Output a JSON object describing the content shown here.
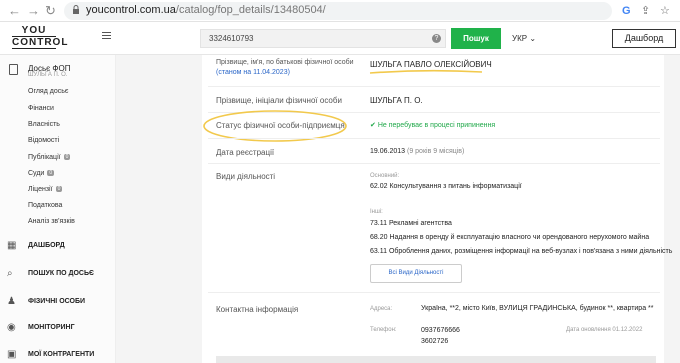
{
  "browser": {
    "url_host": "youcontrol.com.ua",
    "url_path": "/catalog/fop_details/13480504/"
  },
  "logo": {
    "line1": "YOU",
    "line2": "CONTROL"
  },
  "search": {
    "value": "3324610793",
    "button": "Пошук",
    "help": "?"
  },
  "lang": "УКР",
  "dashboard_btn": "Дашборд",
  "sidebar": {
    "dossier_title": "Досьє ФОП",
    "dossier_sub": "ШУЛЬГА П. О.",
    "sub_items": [
      {
        "label": "Огляд досьє"
      },
      {
        "label": "Фінанси"
      },
      {
        "label": "Власність"
      },
      {
        "label": "Відомості"
      },
      {
        "label": "Публікації",
        "badge": "0"
      },
      {
        "label": "Суди",
        "badge": "0"
      },
      {
        "label": "Ліцензії",
        "badge": "0"
      },
      {
        "label": "Податкова"
      },
      {
        "label": "Аналіз зв'язків"
      }
    ],
    "main_items": [
      {
        "label": "ДАШБОРД",
        "icon": "dashboard-icon"
      },
      {
        "label": "ПОШУК ПО ДОСЬЄ",
        "icon": "search-dossier-icon"
      },
      {
        "label": "ФІЗИЧНІ ОСОБИ",
        "icon": "person-icon"
      },
      {
        "label": "МОНІТОРИНГ",
        "icon": "eye-icon"
      },
      {
        "label": "МОЇ КОНТРАГЕНТИ",
        "icon": "folder-icon"
      }
    ]
  },
  "details": {
    "name_label": "Прізвище, ім'я, по батькові фізичної особи",
    "name_date": "(станом на 11.04.2023)",
    "name_value": "ШУЛЬГА ПАВЛО ОЛЕКСІЙОВИЧ",
    "initials_label": "Прізвище, ініціали фізичної особи",
    "initials_value": "ШУЛЬГА П. О.",
    "status_label": "Статус фізичної особи-підприємця",
    "status_value": "Не перебуває в процесі припинення",
    "regdate_label": "Дата реєстрації",
    "regdate_value": "19.06.2013",
    "regdate_extra": "(9 років 9 місяців)",
    "activities_label": "Види діяльності",
    "main_label": "Основний:",
    "main_value": "62.02 Консультування з питань інформатизації",
    "other_label": "Інші:",
    "other_values": [
      "73.11 Рекламні агентства",
      "68.20 Надання в оренду й експлуатацію власного чи орендованого нерухомого майна",
      "63.11 Оброблення даних, розміщення інформації на веб-вузлах і пов'язана з ними діяльність"
    ],
    "all_activities_btn": "Всі Види Діяльності",
    "contact_label": "Контактна інформація",
    "address_label": "Адреса:",
    "address_value": "Україна, **2, місто Київ, ВУЛИЦЯ ГРАДИНСЬКА, будинок **, квартира **",
    "phone_label": "Телефон:",
    "phone_1": "0937676666",
    "phone_2": "3602726",
    "updated": "Дата оновлення 01.12.2022"
  }
}
